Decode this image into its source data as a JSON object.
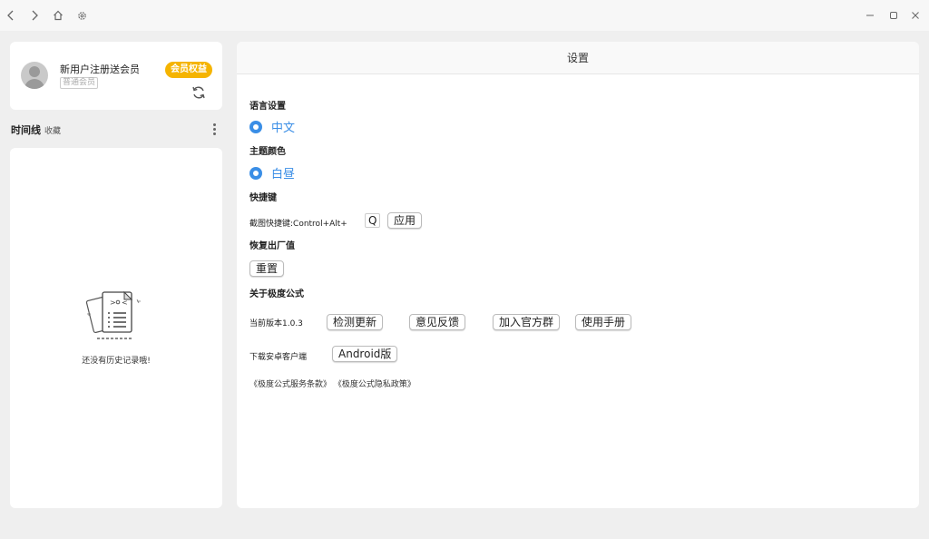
{
  "titlebar": {
    "back_icon": "chevron-left-icon",
    "forward_icon": "chevron-right-icon",
    "home_icon": "home-icon",
    "settings_icon": "gear-icon",
    "minimize_icon": "minimize-icon",
    "maximize_icon": "maximize-icon",
    "close_icon": "close-icon"
  },
  "user": {
    "name": "新用户注册送会员",
    "level": "普通会员",
    "vip_badge": "会员权益",
    "vip_color": "#f5b400"
  },
  "timeline": {
    "title": "时间线",
    "favorites": "收藏",
    "empty_text": "还没有历史记录哦!"
  },
  "settings": {
    "title": "设置",
    "accent_color": "#3a8ee6",
    "language": {
      "label": "语言设置",
      "value": "中文"
    },
    "theme": {
      "label": "主题颜色",
      "value": "白昼"
    },
    "shortcut": {
      "label": "快捷键",
      "desc": "截图快捷键:Control+Alt+",
      "key": "Q",
      "apply": "应用"
    },
    "reset": {
      "label": "恢复出厂值",
      "button": "重置"
    },
    "about": {
      "label": "关于极度公式",
      "version": "当前版本1.0.3",
      "check_update": "检测更新",
      "feedback": "意见反馈",
      "join_group": "加入官方群",
      "manual": "使用手册"
    },
    "android": {
      "label": "下载安卓客户端",
      "button": "Android版"
    },
    "links": {
      "terms": "《极度公式服务条款》",
      "privacy": "《极度公式隐私政策》"
    }
  }
}
